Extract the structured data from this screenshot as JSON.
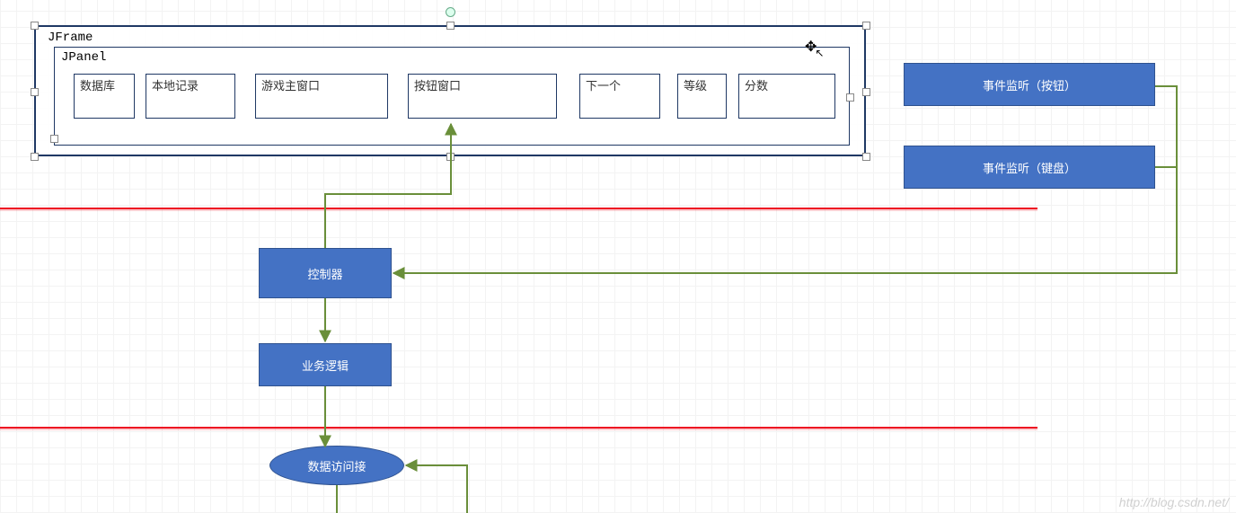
{
  "frame": {
    "jframe_label": "JFrame",
    "jpanel_label": "JPanel",
    "panels": [
      "数据库",
      "本地记录",
      "游戏主窗口",
      "按钮窗口",
      "下一个",
      "等级",
      "分数"
    ]
  },
  "listeners": {
    "button": "事件监听（按钮）",
    "keyboard": "事件监听（键盘）"
  },
  "flow": {
    "controller": "控制器",
    "logic": "业务逻辑",
    "dao": "数据访问接"
  },
  "watermark": "http://blog.csdn.net/"
}
